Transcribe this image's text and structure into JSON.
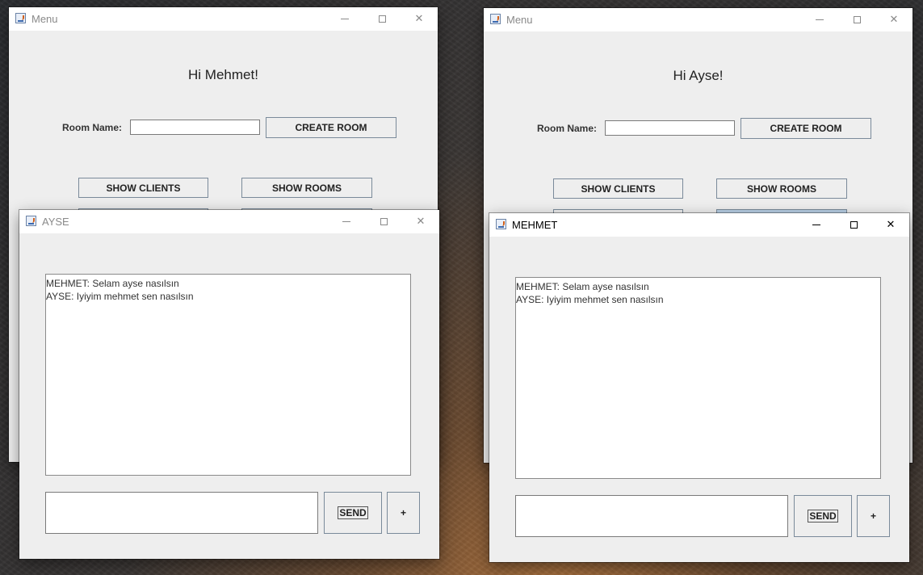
{
  "menu_windows": {
    "left": {
      "title": "Menu",
      "greeting": "Hi Mehmet!",
      "room_name_label": "Room Name:",
      "room_name_value": "",
      "create_room_label": "CREATE ROOM",
      "show_clients_label": "SHOW CLIENTS",
      "show_rooms_label": "SHOW ROOMS"
    },
    "right": {
      "title": "Menu",
      "greeting": "Hi Ayse!",
      "room_name_label": "Room Name:",
      "room_name_value": "",
      "create_room_label": "CREATE ROOM",
      "show_clients_label": "SHOW CLIENTS",
      "show_rooms_label": "SHOW ROOMS"
    }
  },
  "chat_windows": {
    "ayse": {
      "title": "AYSE",
      "messages": [
        "MEHMET: Selam ayse nasılsın",
        "AYSE: Iyiyim mehmet sen nasılsın"
      ],
      "input_value": "",
      "send_label": "SEND",
      "plus_label": "+"
    },
    "mehmet": {
      "title": "MEHMET",
      "messages": [
        "MEHMET: Selam ayse nasılsın",
        "AYSE: Iyiyim mehmet sen nasılsın"
      ],
      "input_value": "",
      "send_label": "SEND",
      "plus_label": "+"
    }
  },
  "icons": {
    "app": "java-coffee-icon",
    "minimize": "minimize-icon",
    "maximize": "maximize-icon",
    "close": "close-icon"
  },
  "colors": {
    "window_bg": "#eeeeee",
    "titlebar_bg": "#ffffff",
    "button_border": "#7a8a9a",
    "pressed_button": "#b8cfe5"
  }
}
